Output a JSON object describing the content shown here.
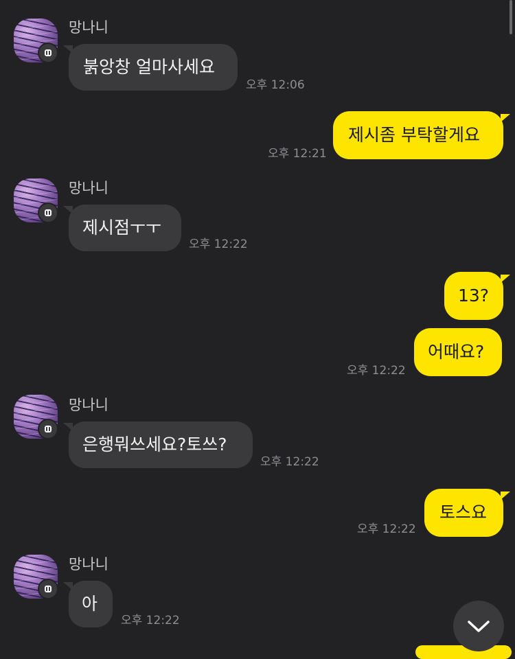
{
  "messages": [
    {
      "sender": "망나니",
      "text": "붉앙창 얼마사세요",
      "time": "오후 12:06",
      "direction": "in"
    },
    {
      "text": "제시좀 부탁할게요",
      "time": "오후 12:21",
      "direction": "out"
    },
    {
      "sender": "망나니",
      "text": "제시점ㅜㅜ",
      "time": "오후 12:22",
      "direction": "in"
    },
    {
      "text": "13?",
      "direction": "out"
    },
    {
      "text": "어때요?",
      "time": "오후 12:22",
      "direction": "out"
    },
    {
      "sender": "망나니",
      "text": "은행뭐쓰세요?토쓰?",
      "time": "오후 12:22",
      "direction": "in"
    },
    {
      "text": "토스요",
      "time": "오후 12:22",
      "direction": "out"
    },
    {
      "sender": "망나니",
      "text": "아",
      "time": "오후 12:22",
      "direction": "in"
    }
  ],
  "colors": {
    "background": "#222224",
    "incoming_bubble": "#3a3a3c",
    "outgoing_bubble": "#fee500",
    "timestamp": "#8e8e93"
  },
  "icons": {
    "scroll_down": "chevron-down-icon",
    "profile_badge": "channel-badge-icon"
  }
}
